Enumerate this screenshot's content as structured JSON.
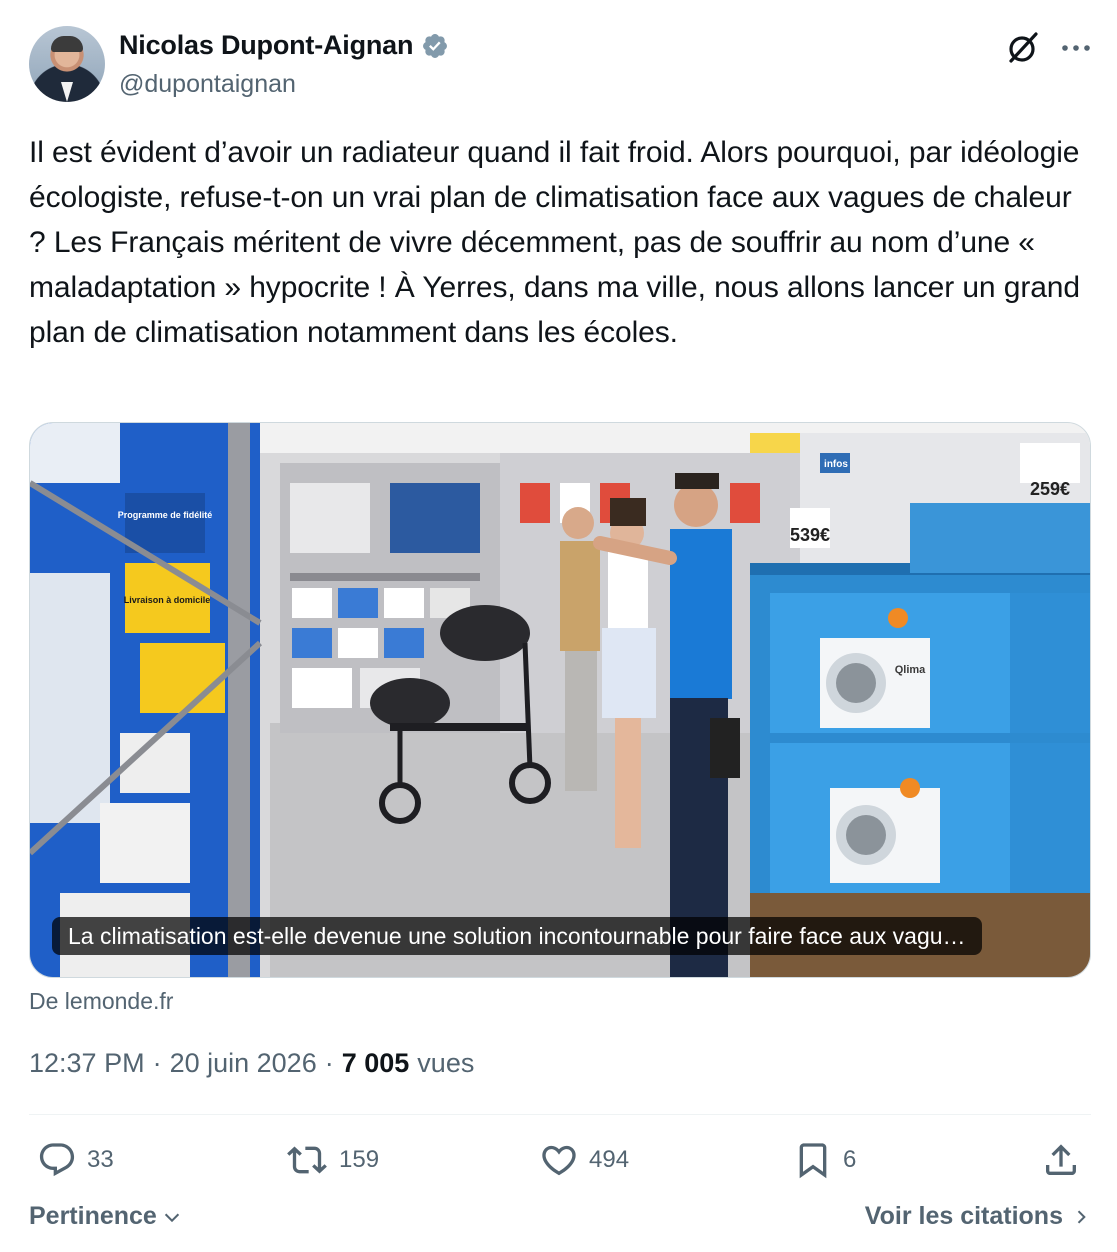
{
  "author": {
    "display_name": "Nicolas Dupont-Aignan",
    "handle": "@dupontaignan",
    "verified": true
  },
  "header_icons": [
    "grok-icon",
    "more-options-icon"
  ],
  "tweet": {
    "text": "Il est évident d’avoir un radiateur quand il fait froid. Alors pourquoi, par idéologie écologiste, refuse-t-on un vrai plan de climatisation face aux vagues de chaleur ? Les Français méritent de vivre décemment, pas de souffrir au nom d’une « maladaptation » hypocrite ! À Yerres, dans ma ville, nous allons lancer un grand plan de climatisation notamment dans les écoles."
  },
  "link_card": {
    "caption": "La climatisation est-elle devenue une solution incontournable pour faire face aux vagu…",
    "source": "De lemonde.fr",
    "photo_text": {
      "sign_fidelite": "Programme de fidélité",
      "sign_livraison": "Livraison à domicile",
      "price_1": "539€",
      "price_2": "259€",
      "infos": "infos",
      "brand": "Qlima"
    }
  },
  "meta": {
    "time": "12:37 PM",
    "date": "20 juin 2026",
    "views_count": "7 005",
    "views_label": "vues",
    "separator": "·"
  },
  "actions": {
    "replies": "33",
    "reposts": "159",
    "likes": "494",
    "bookmarks": "6"
  },
  "footer": {
    "sort_label": "Pertinence",
    "quotes_label": "Voir les citations"
  },
  "colors": {
    "text_primary": "#0f1419",
    "text_secondary": "#536471",
    "verified_badge": "#829aab",
    "border": "#cfd9de",
    "divider": "#eff3f4"
  }
}
